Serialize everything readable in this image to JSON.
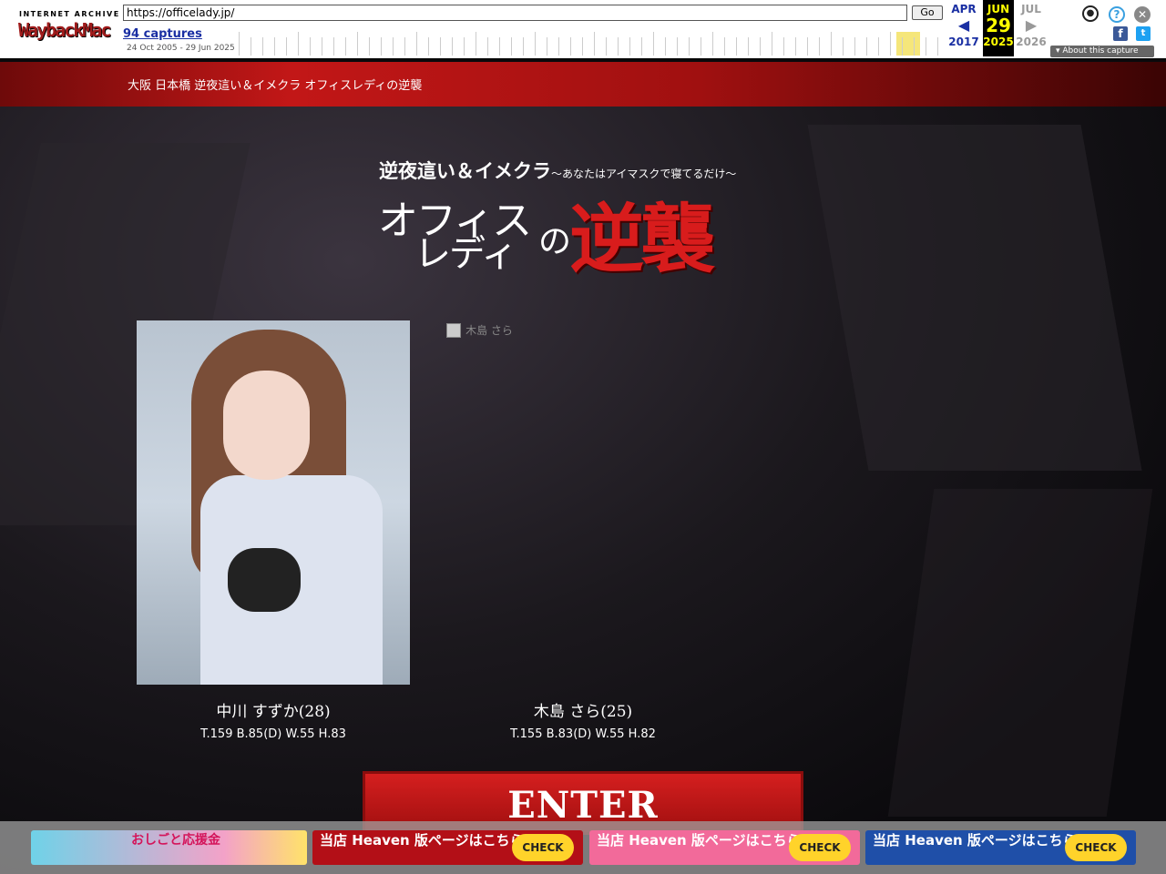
{
  "wayback": {
    "logo_top": "INTERNET ARCHIVE",
    "logo_main": "WaybackMachine",
    "url": "https://officelady.jp/",
    "go_label": "Go",
    "captures": "94 captures",
    "range": "24 Oct 2005 - 29 Jun 2025",
    "prev": {
      "month": "APR",
      "year": "2017"
    },
    "current": {
      "month": "JUN",
      "day": "29",
      "year": "2025"
    },
    "next": {
      "month": "JUL",
      "year": "2026"
    },
    "about": "About this capture"
  },
  "site": {
    "header_title": "大阪 日本橋 逆夜這い＆イメクラ オフィスレディの逆襲"
  },
  "logo": {
    "subtitle": "逆夜這い＆イメクラ",
    "subtitle_small": "～あなたはアイマスクで寝てるだけ～",
    "main_line1": "オフィス",
    "main_line2": "レディ",
    "no": "の",
    "red": "逆襲"
  },
  "cast": [
    {
      "name": "中川 すずか(28)",
      "spec": "T.159 B.85(D) W.55 H.83"
    },
    {
      "name": "木島 さら(25)",
      "spec": "T.155 B.83(D) W.55 H.82",
      "alt": "木島 さら"
    }
  ],
  "enter_label": "ENTER",
  "banners": [
    {
      "text": "おしごと応援金",
      "check": ""
    },
    {
      "text": "当店 Heaven 版ページはこちら",
      "check": "CHECK"
    },
    {
      "text": "当店 Heaven 版ページはこちら",
      "check": "CHECK"
    },
    {
      "text": "当店 Heaven 版ページはこちら",
      "check": "CHECK"
    }
  ],
  "colors": {
    "accent_red": "#c21717",
    "wayback_highlight": "#ffff00"
  }
}
